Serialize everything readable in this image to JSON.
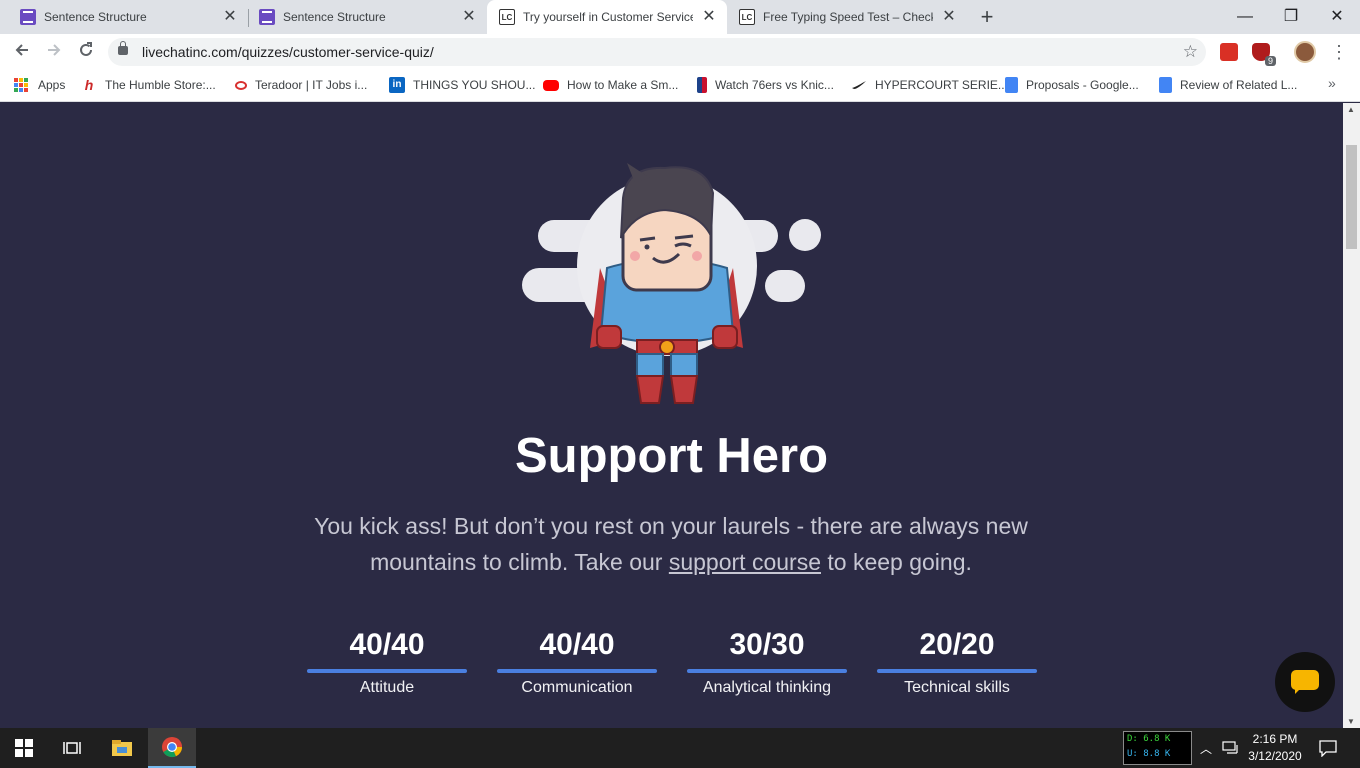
{
  "tabs": [
    {
      "title": "Sentence Structure",
      "icon": "forms-icon"
    },
    {
      "title": "Sentence Structure",
      "icon": "forms-icon"
    },
    {
      "title": "Try yourself in Customer Service",
      "icon": "livechat-icon"
    },
    {
      "title": "Free Typing Speed Test – Check y",
      "icon": "livechat-icon"
    }
  ],
  "tab_close_glyph": "✕",
  "new_tab_glyph": "+",
  "window": {
    "minimize": "—",
    "maximize": "❐",
    "close": "✕"
  },
  "address_bar": {
    "url": "livechatinc.com/quizzes/customer-service-quiz/"
  },
  "extension_badge": "9",
  "bookmarks": [
    {
      "label": "Apps"
    },
    {
      "label": "The Humble Store:..."
    },
    {
      "label": "Teradoor | IT Jobs i..."
    },
    {
      "label": "THINGS YOU SHOU..."
    },
    {
      "label": "How to Make a Sm..."
    },
    {
      "label": "Watch 76ers vs Knic..."
    },
    {
      "label": "HYPERCOURT SERIE..."
    },
    {
      "label": "Proposals - Google..."
    },
    {
      "label": "Review of Related L..."
    }
  ],
  "bookmarks_more": "»",
  "result": {
    "title": "Support Hero",
    "desc_before": "You kick ass! But don’t you rest on your laurels - there are always new mountains to climb. Take our ",
    "desc_link": "support course",
    "desc_after": " to keep going."
  },
  "scores": [
    {
      "value": "40/40",
      "label": "Attitude"
    },
    {
      "value": "40/40",
      "label": "Communication"
    },
    {
      "value": "30/30",
      "label": "Analytical thinking"
    },
    {
      "value": "20/20",
      "label": "Technical skills"
    }
  ],
  "taskbar": {
    "net_down": "D: 6.8 K",
    "net_up": "U: 8.8 K",
    "time": "2:16 PM",
    "date": "3/12/2020"
  },
  "colors": {
    "page_bg": "#2b2a44",
    "accent_bar": "#4a7fe0",
    "chat_bubble": "#f7b500"
  }
}
